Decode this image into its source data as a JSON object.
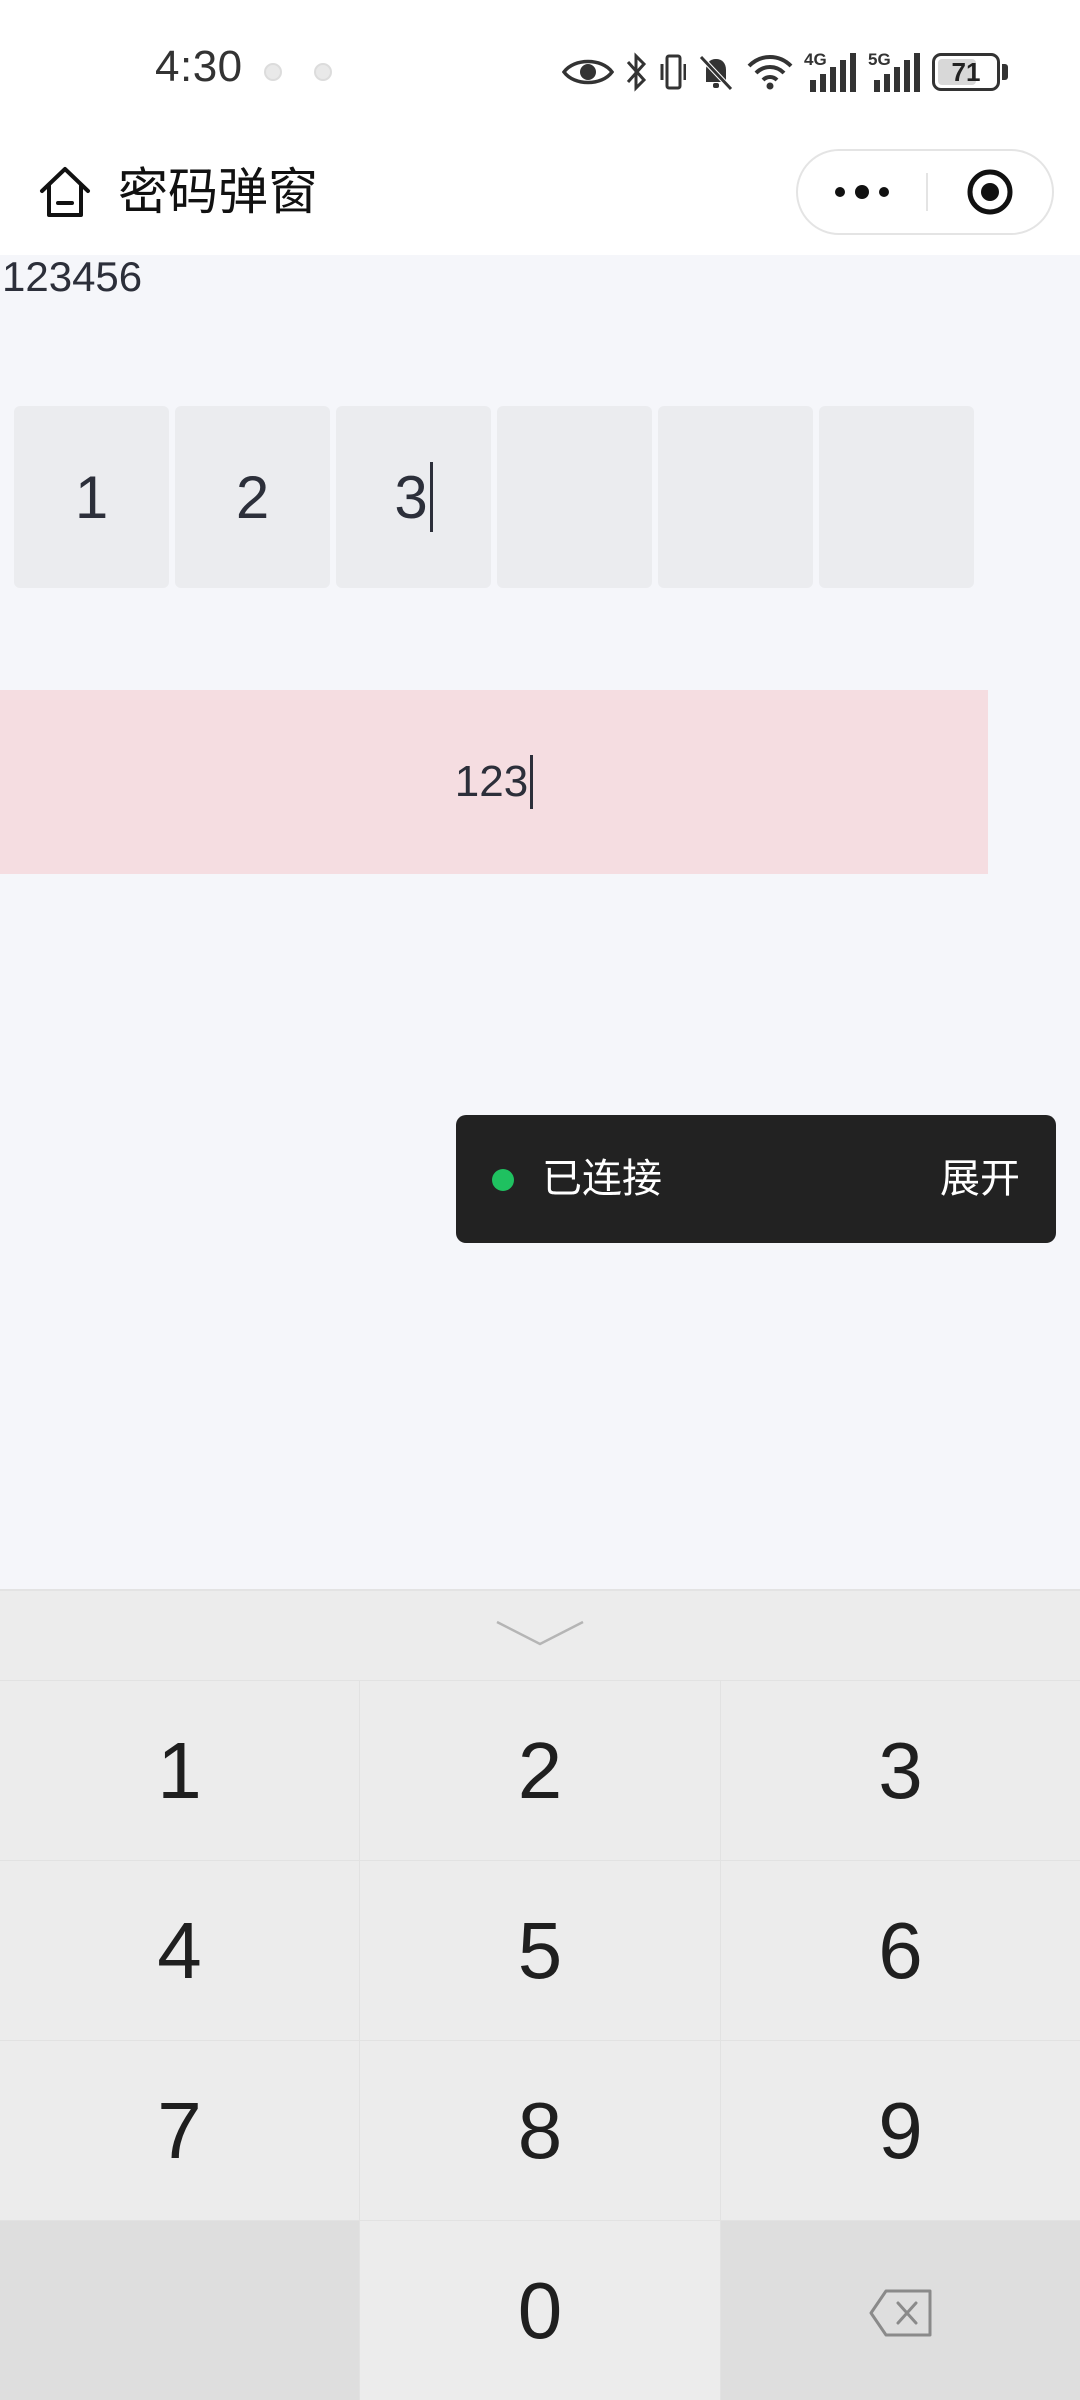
{
  "status_bar": {
    "time": "4:30",
    "battery_level": "71",
    "icons": [
      "eye-icon",
      "bluetooth-icon",
      "vibrate-icon",
      "mute-bell-icon",
      "wifi-icon",
      "signal-4g-icon",
      "signal-5g-icon"
    ],
    "labels": {
      "net1": "4G",
      "net2": "5G"
    }
  },
  "nav": {
    "title": "密码弹窗",
    "home_icon": "home-icon",
    "more_icon": "more-dots-icon",
    "close_icon": "target-close-icon"
  },
  "content": {
    "value_text": "123456",
    "pin_cells": [
      "1",
      "2",
      "3",
      "",
      "",
      ""
    ],
    "plain_input_value": "123"
  },
  "toast": {
    "status_text": "已连接",
    "action_label": "展开",
    "status_color": "#1fc160"
  },
  "keyboard": {
    "collapse_icon": "chevron-down-icon",
    "keys": [
      "1",
      "2",
      "3",
      "4",
      "5",
      "6",
      "7",
      "8",
      "9",
      "",
      "0",
      "backspace"
    ],
    "delete_icon": "backspace-icon"
  }
}
